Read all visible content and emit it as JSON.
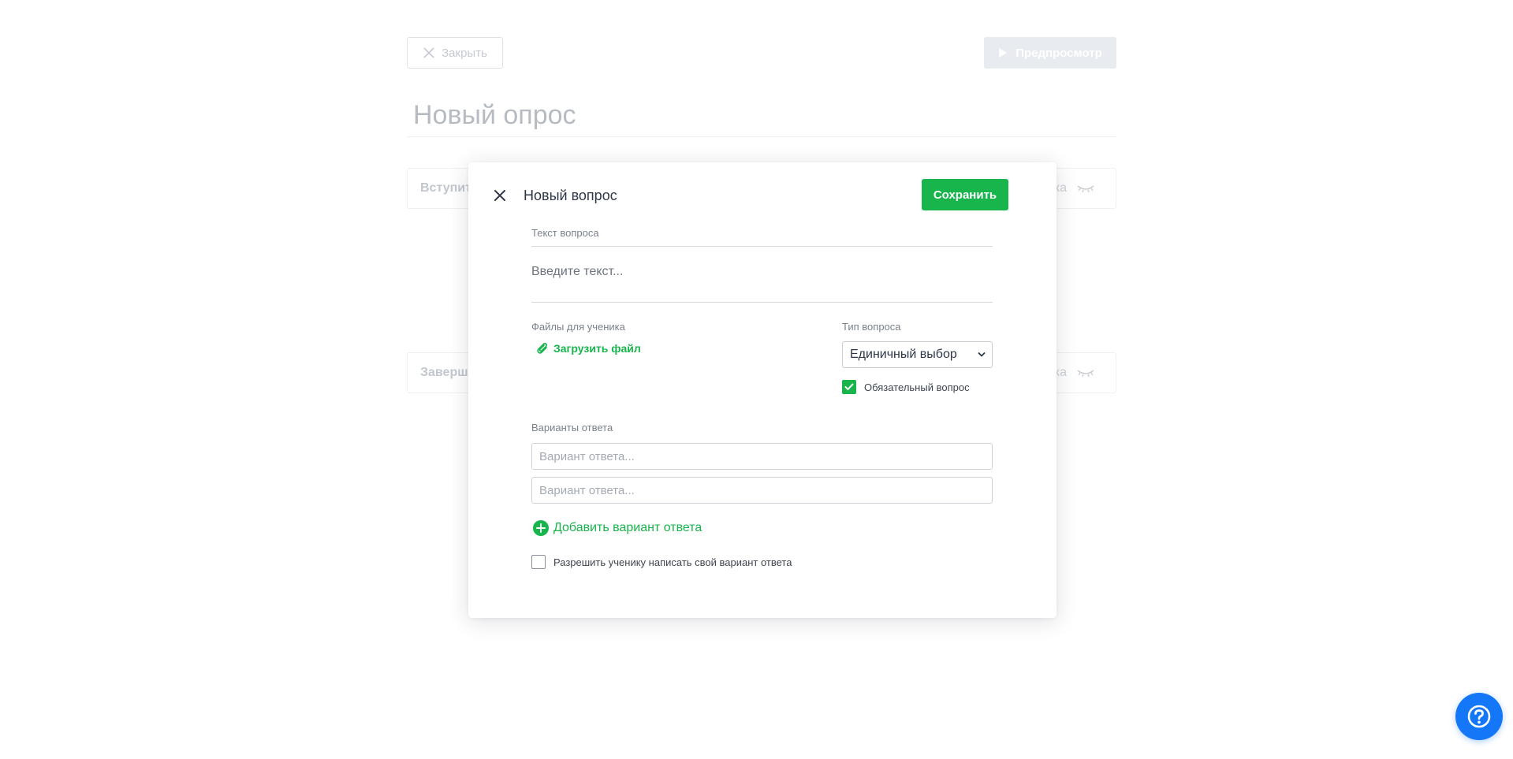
{
  "background": {
    "close_label": "Закрыть",
    "preview_label": "Предпросмотр",
    "survey_title": "Новый опрос",
    "sections": [
      {
        "title": "Вступит",
        "side_text": "ка"
      },
      {
        "title": "Заверш",
        "side_text": "ка"
      }
    ]
  },
  "modal": {
    "title": "Новый вопрос",
    "save_label": "Сохранить",
    "question_label": "Текст вопроса",
    "question_placeholder": "Введите текст...",
    "files_label": "Файлы для ученика",
    "upload_label": "Загрузить файл",
    "type_label": "Тип вопроса",
    "type_value": "Единичный выбор",
    "required_label": "Обязательный вопрос",
    "required_checked": true,
    "answers_label": "Варианты ответа",
    "answers": [
      {
        "placeholder": "Вариант ответа...",
        "value": ""
      },
      {
        "placeholder": "Вариант ответа...",
        "value": ""
      }
    ],
    "add_answer_label": "Добавить вариант ответа",
    "allow_own_label": "Разрешить ученику написать свой вариант ответа",
    "allow_own_checked": false
  },
  "colors": {
    "accent_green": "#17b54b",
    "help_blue": "#1477f8"
  },
  "icons": {
    "modal_close": "close-icon",
    "upload": "paperclip-icon",
    "add_answer": "plus-circle-icon",
    "help": "question-icon",
    "section_visibility": "eye-closed-icon"
  }
}
